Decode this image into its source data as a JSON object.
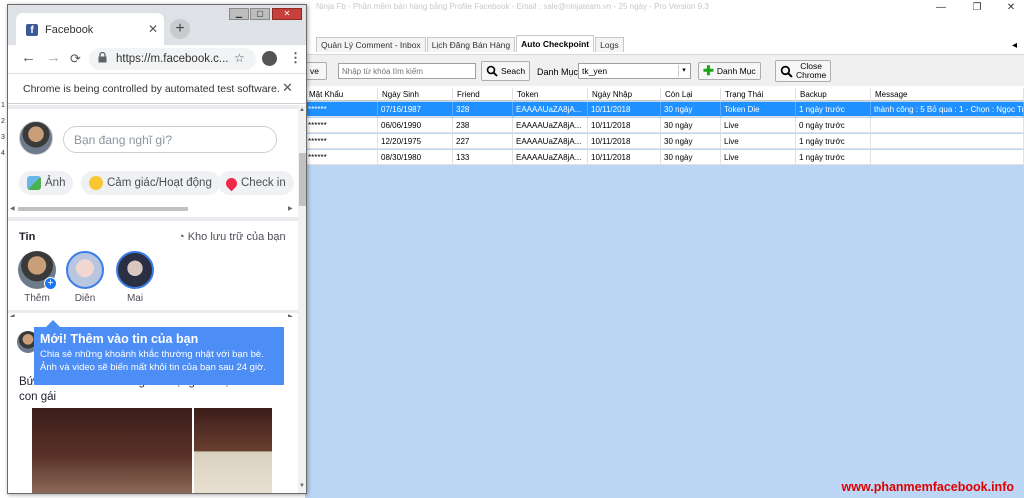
{
  "app": {
    "title": "Ninja Fb - Phần mềm bán hàng bằng Profile Facebook - Email : sale@ninjateam.vn - 25 ngày - Pro Version 9.3",
    "window_controls": {
      "minimize": "—",
      "maximize": "❐",
      "close": "✕"
    },
    "tabs": [
      {
        "label": "Quản Lý Comment - Inbox",
        "active": false
      },
      {
        "label": "Lịch Đăng Bán Hàng",
        "active": false
      },
      {
        "label": "Auto Checkpoint",
        "active": true
      },
      {
        "label": "Logs",
        "active": false
      }
    ],
    "toolbar": {
      "partial_button_label": "ve",
      "search_placeholder": "Nhập từ khóa tìm kiếm",
      "search_label": "Seach",
      "category_label": "Danh Mục",
      "category_value": "tk_yen",
      "add_category_label": "Danh Mục",
      "close_chrome_label_1": "Close",
      "close_chrome_label_2": "Chrome"
    },
    "grid": {
      "columns": [
        "Mật Khẩu",
        "Ngày Sinh",
        "Friend",
        "Token",
        "Ngày Nhập",
        "Còn Lại",
        "Trạng Thái",
        "Backup",
        "Message"
      ],
      "rows": [
        [
          "******",
          "07/16/1987",
          "328",
          "EAAAAUaZA8jA...",
          "10/11/2018",
          "30 ngày",
          "Token Die",
          "1 ngày trước",
          "thành công : 5 Bỏ qua : 1 - Chọn : Ngọc Tr"
        ],
        [
          "******",
          "06/06/1990",
          "238",
          "EAAAAUaZA8jA...",
          "10/11/2018",
          "30 ngày",
          "Live",
          "0 ngày trước",
          ""
        ],
        [
          "******",
          "12/20/1975",
          "227",
          "EAAAAUaZA8jA...",
          "10/11/2018",
          "30 ngày",
          "Live",
          "1 ngày trước",
          ""
        ],
        [
          "******",
          "08/30/1980",
          "133",
          "EAAAAUaZA8jA...",
          "10/11/2018",
          "30 ngày",
          "Live",
          "1 ngày trước",
          ""
        ]
      ],
      "selected_row": 0,
      "row_numbers": [
        "1",
        "2",
        "3",
        "4"
      ]
    },
    "watermark": "www.phanmemfacebook.info",
    "colors": {
      "selection": "#1e90ff",
      "grid_bg": "#bcd6f5",
      "watermark": "#e10000"
    }
  },
  "chrome": {
    "tab_title": "Facebook",
    "tab_close": "✕",
    "new_tab": "+",
    "url": "https://m.facebook.c...",
    "infobar_text": "Chrome is being controlled by automated test software.",
    "infobar_close": "✕",
    "nav": {
      "back": "←",
      "forward": "→",
      "reload": "C",
      "star": "☆",
      "menu": "⋮",
      "lock": "🔒"
    }
  },
  "facebook": {
    "composer_placeholder": "Bạn đang nghĩ gì?",
    "chips": [
      {
        "label": "Ảnh",
        "icon": "photo-icon"
      },
      {
        "label": "Cảm giác/Hoạt động",
        "icon": "emoji-icon"
      },
      {
        "label": "Check in",
        "icon": "location-pin-icon"
      }
    ],
    "stories_title": "Tin",
    "stories_archive": "Kho lưu trữ của bạn",
    "stories": [
      {
        "name": "Thêm"
      },
      {
        "name": "Diên"
      },
      {
        "name": "Mai"
      }
    ],
    "tooltip": {
      "title": "Mới! Thêm vào tin của bạn",
      "body": "Chia sẻ những khoảnh khắc thường nhật với bạn bè. Ảnh và video sẽ biến mất khỏi tin của bạn sau 24 giờ."
    },
    "post_text": "Bức tranh đầu tiên con gái vẽ tặng bố mẹ cảm ơn con gái"
  }
}
